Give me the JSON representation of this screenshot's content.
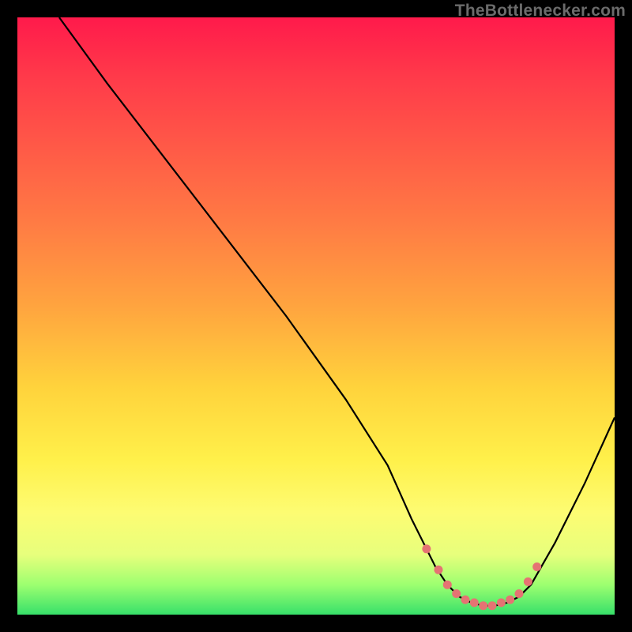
{
  "watermark": {
    "text": "TheBottlenecker.com"
  },
  "palette": {
    "frame": "#000000",
    "curve": "#000000",
    "marker": "#e57373",
    "gradient_top": "#ff1a4b",
    "gradient_bottom": "#37e06a"
  },
  "chart_data": {
    "type": "line",
    "title": "",
    "xlabel": "",
    "ylabel": "",
    "xlim": [
      0,
      100
    ],
    "ylim": [
      0,
      100
    ],
    "grid": false,
    "series": [
      {
        "name": "bottleneck-curve",
        "x": [
          7,
          15,
          25,
          35,
          45,
          55,
          62,
          66,
          70,
          72,
          74,
          76,
          78,
          80,
          82,
          84,
          86,
          90,
          95,
          100
        ],
        "y": [
          100,
          89,
          76,
          63,
          50,
          36,
          25,
          16,
          8,
          5,
          3,
          2,
          1.5,
          1.5,
          2,
          3,
          5,
          12,
          22,
          33
        ]
      }
    ],
    "markers": {
      "name": "optimal-range",
      "x": [
        68.5,
        70.5,
        72,
        73.5,
        75,
        76.5,
        78,
        79.5,
        81,
        82.5,
        84,
        85.5,
        87
      ],
      "y": [
        11,
        7.5,
        5,
        3.5,
        2.5,
        2,
        1.5,
        1.5,
        2,
        2.5,
        3.5,
        5.5,
        8
      ]
    }
  }
}
